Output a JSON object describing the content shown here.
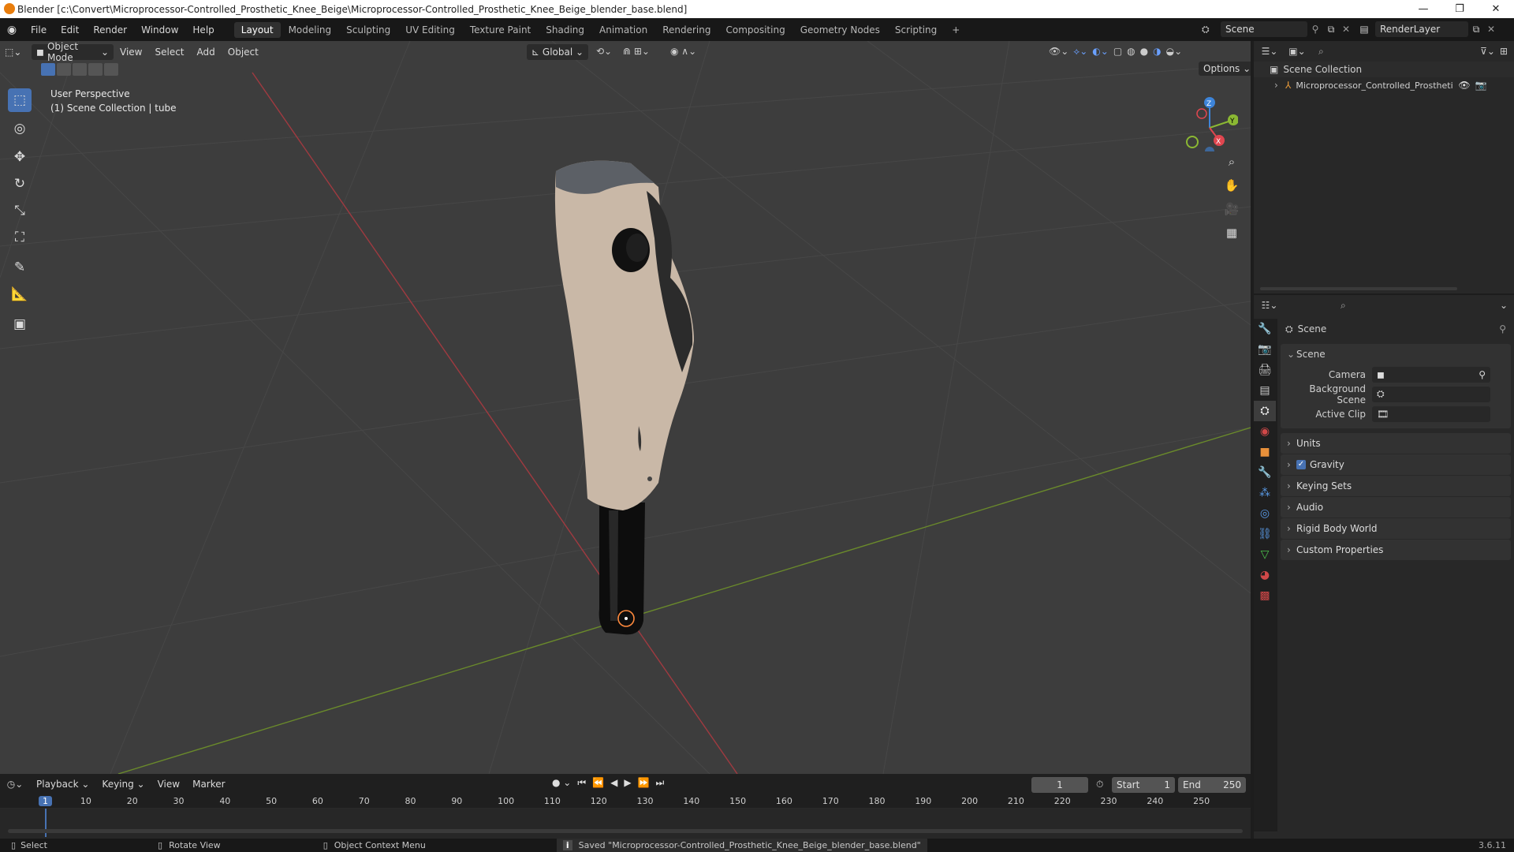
{
  "window": {
    "title": "Blender [c:\\Convert\\Microprocessor-Controlled_Prosthetic_Knee_Beige\\Microprocessor-Controlled_Prosthetic_Knee_Beige_blender_base.blend]"
  },
  "menu": [
    "File",
    "Edit",
    "Render",
    "Window",
    "Help"
  ],
  "workspaces": [
    "Layout",
    "Modeling",
    "Sculpting",
    "UV Editing",
    "Texture Paint",
    "Shading",
    "Animation",
    "Rendering",
    "Compositing",
    "Geometry Nodes",
    "Scripting"
  ],
  "active_workspace": "Layout",
  "scene_name": "Scene",
  "view_layer": "RenderLayer",
  "viewport": {
    "mode": "Object Mode",
    "menus": [
      "View",
      "Select",
      "Add",
      "Object"
    ],
    "transform_orientation": "Global",
    "options_label": "Options",
    "perspective_label": "User Perspective",
    "collection_label": "(1) Scene Collection | tube",
    "gizmo": {
      "z": "Z",
      "y": "Y",
      "x": "X"
    }
  },
  "outliner": {
    "root": "Scene Collection",
    "object": "Microprocessor_Controlled_Prosthetic_K"
  },
  "properties": {
    "header": "Scene",
    "section": "Scene",
    "fields": [
      {
        "label": "Camera",
        "icon": "camera-icon"
      },
      {
        "label": "Background Scene",
        "icon": "scene-icon"
      },
      {
        "label": "Active Clip",
        "icon": "clip-icon"
      }
    ],
    "panels": [
      "Units",
      "Gravity",
      "Keying Sets",
      "Audio",
      "Rigid Body World",
      "Custom Properties"
    ],
    "gravity_enabled": true
  },
  "timeline": {
    "menus": [
      "Playback",
      "Keying",
      "View",
      "Marker"
    ],
    "current_frame": "1",
    "start_label": "Start",
    "start": "1",
    "end_label": "End",
    "end": "250",
    "ruler": [
      "1",
      "10",
      "20",
      "30",
      "40",
      "50",
      "60",
      "70",
      "80",
      "90",
      "100",
      "110",
      "120",
      "130",
      "140",
      "150",
      "160",
      "170",
      "180",
      "190",
      "200",
      "210",
      "220",
      "230",
      "240",
      "250"
    ]
  },
  "status": {
    "select": "Select",
    "rotate": "Rotate View",
    "context": "Object Context Menu",
    "message": "Saved \"Microprocessor-Controlled_Prosthetic_Knee_Beige_blender_base.blend\"",
    "version": "3.6.11"
  },
  "colors": {
    "accent": "#4772b3",
    "x_axis": "#e0464f",
    "y_axis": "#8bb833",
    "z_axis": "#3d84d9"
  }
}
